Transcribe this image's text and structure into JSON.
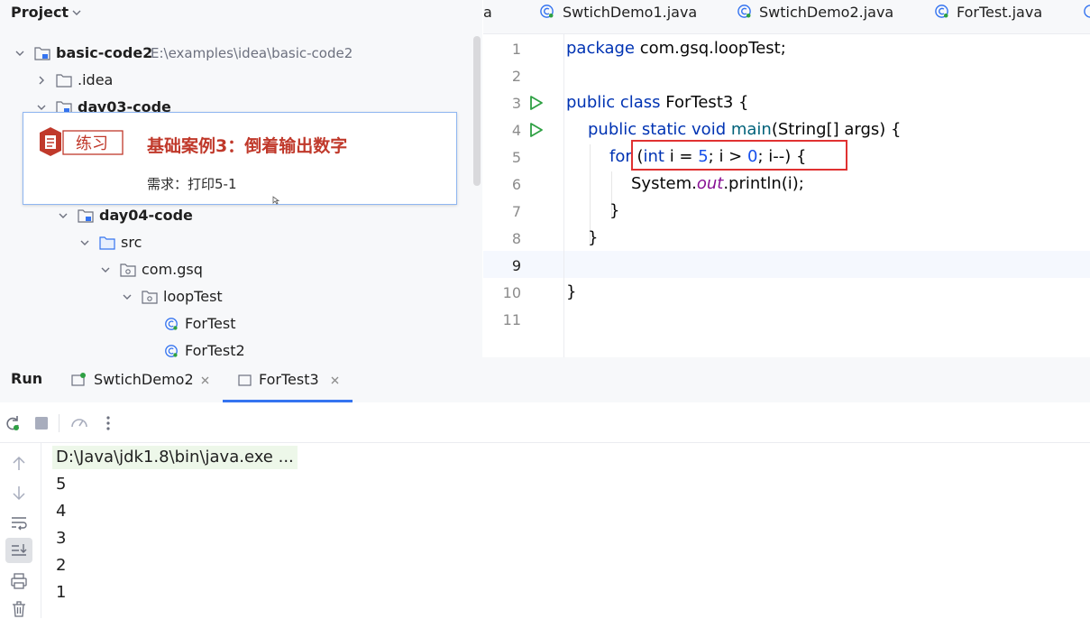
{
  "project": {
    "title": "Project",
    "tree": [
      {
        "label": "basic-code2",
        "path": "E:\\examples\\idea\\basic-code2"
      },
      {
        "label": ".idea"
      },
      {
        "label": "day03-code"
      },
      {
        "label": "day04-code"
      },
      {
        "label": "src"
      },
      {
        "label": "com.gsq"
      },
      {
        "label": "loopTest"
      },
      {
        "label": "ForTest"
      },
      {
        "label": "ForTest2"
      }
    ]
  },
  "overlay": {
    "badge_label": "练习",
    "title": "基础案例3：倒着输出数字",
    "subtitle": "需求：打印5-1"
  },
  "editor": {
    "tabs": [
      {
        "label": "a"
      },
      {
        "label": "SwtichDemo1.java"
      },
      {
        "label": "SwtichDemo2.java"
      },
      {
        "label": "ForTest.java"
      }
    ],
    "line_numbers": [
      "1",
      "2",
      "3",
      "4",
      "5",
      "6",
      "7",
      "8",
      "9",
      "10",
      "11"
    ],
    "code": {
      "l1_kw": "package",
      "l1_rest": " com.gsq.loopTest;",
      "l3_kw": "public class",
      "l3_rest": " ForTest3 {",
      "l4_kw": "public static void",
      "l4_fn": "main",
      "l4_rest": "(String[] args) {",
      "l5_kw": "for",
      "l5_p1": " (",
      "l5_kw2": "int",
      "l5_p2": " i = ",
      "l5_n1": "5",
      "l5_p3": "; i > ",
      "l5_n2": "0",
      "l5_p4": "; i--) {",
      "l6_p1": "System.",
      "l6_fld": "out",
      "l6_p2": ".println(i);",
      "l7": "}",
      "l8": "}",
      "l10": "}"
    }
  },
  "run": {
    "title": "Run",
    "tabs": [
      {
        "label": "SwtichDemo2"
      },
      {
        "label": "ForTest3"
      }
    ],
    "command": "D:\\Java\\jdk1.8\\bin\\java.exe ...",
    "output": [
      "5",
      "4",
      "3",
      "2",
      "1"
    ]
  },
  "colors": {
    "accent": "#3574f0",
    "highlight_box": "#e03131",
    "overlay_title": "#c0392b",
    "run_icon": "#2ea043"
  }
}
